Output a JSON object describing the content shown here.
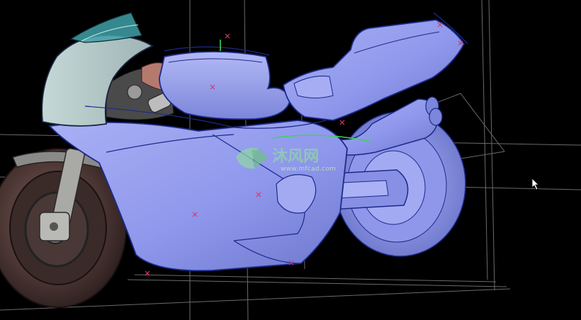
{
  "viewport": {
    "background": "#000000",
    "surface_color": "#8f98ec",
    "surface_shade": "#6a74c8",
    "edge_color": "#1c2a8a",
    "construction_line_color": "#6b6b6b",
    "point_marker_color": "#d23a6a"
  },
  "watermark": {
    "title": "沐风网",
    "url": "www.mfcad.com",
    "color": "#8fd4a6"
  },
  "icons": {
    "cursor": "mouse-pointer-icon",
    "logo": "mfcad-logo-icon"
  }
}
